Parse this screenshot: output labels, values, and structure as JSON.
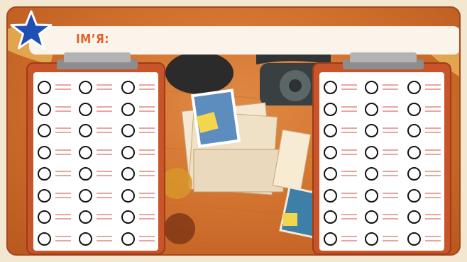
{
  "header": {
    "name_label": "ІМ’Я:",
    "star_icon": "star-icon",
    "star_color": "#1f4fb3"
  },
  "sheets": [
    {
      "id": "left",
      "rows": 8,
      "columns": 3
    },
    {
      "id": "right",
      "rows": 8,
      "columns": 3
    }
  ],
  "colors": {
    "desk": "#d2742f",
    "clipboard": "#c8552a",
    "label": "#e0622b",
    "lines": "#e9a5a1"
  }
}
